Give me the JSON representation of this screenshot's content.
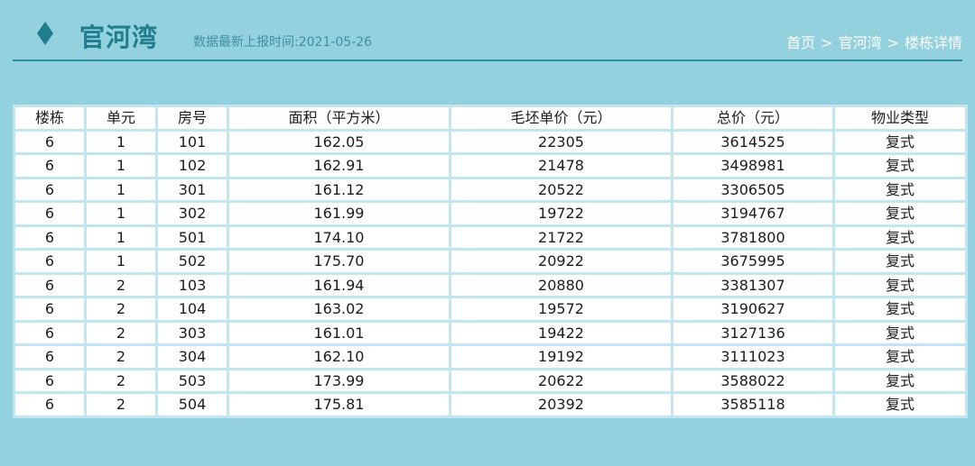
{
  "header": {
    "title": "官河湾",
    "updated": "数据最新上报时间:2021-05-26",
    "breadcrumb": [
      "首页",
      "官河湾",
      "楼栋详情"
    ]
  },
  "table": {
    "headers": [
      "楼栋",
      "单元",
      "房号",
      "面积（平方米）",
      "毛坯单价（元）",
      "总价（元）",
      "物业类型"
    ],
    "rows": [
      [
        "6",
        "1",
        "101",
        "162.05",
        "22305",
        "3614525",
        "复式"
      ],
      [
        "6",
        "1",
        "102",
        "162.91",
        "21478",
        "3498981",
        "复式"
      ],
      [
        "6",
        "1",
        "301",
        "161.12",
        "20522",
        "3306505",
        "复式"
      ],
      [
        "6",
        "1",
        "302",
        "161.99",
        "19722",
        "3194767",
        "复式"
      ],
      [
        "6",
        "1",
        "501",
        "174.10",
        "21722",
        "3781800",
        "复式"
      ],
      [
        "6",
        "1",
        "502",
        "175.70",
        "20922",
        "3675995",
        "复式"
      ],
      [
        "6",
        "2",
        "103",
        "161.94",
        "20880",
        "3381307",
        "复式"
      ],
      [
        "6",
        "2",
        "104",
        "163.02",
        "19572",
        "3190627",
        "复式"
      ],
      [
        "6",
        "2",
        "303",
        "161.01",
        "19422",
        "3127136",
        "复式"
      ],
      [
        "6",
        "2",
        "304",
        "162.10",
        "19192",
        "3111023",
        "复式"
      ],
      [
        "6",
        "2",
        "503",
        "173.99",
        "20622",
        "3588022",
        "复式"
      ],
      [
        "6",
        "2",
        "504",
        "175.81",
        "20392",
        "3585118",
        "复式"
      ]
    ]
  },
  "colors": {
    "background": "#93d1df",
    "accent": "#1f7d8e",
    "grid": "#c2e6ef"
  }
}
